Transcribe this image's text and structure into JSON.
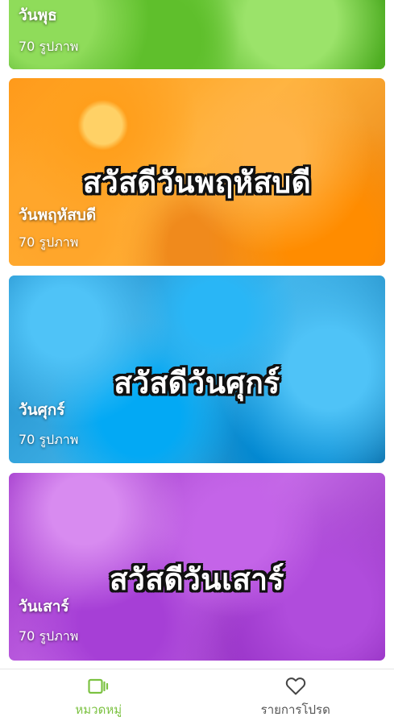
{
  "cards": [
    {
      "id": "wednesday",
      "banner": "",
      "name": "วันพุธ",
      "count": "70 รูปภาพ"
    },
    {
      "id": "thursday",
      "banner": "สวัสดีวันพฤหัสบดี",
      "name": "วันพฤหัสบดี",
      "count": "70 รูปภาพ"
    },
    {
      "id": "friday",
      "banner": "สวัสดีวันศุกร์",
      "name": "วันศุกร์",
      "count": "70 รูปภาพ"
    },
    {
      "id": "saturday",
      "banner": "สวัสดีวันเสาร์",
      "name": "วันเสาร์",
      "count": "70 รูปภาพ"
    }
  ],
  "bottom_nav": {
    "items": [
      {
        "label": "หมวดหมู่",
        "icon": "category-icon",
        "active": true
      },
      {
        "label": "รายการโปรด",
        "icon": "heart-icon",
        "active": false
      }
    ]
  },
  "colors": {
    "accent": "#7cc242",
    "inactive": "#555555"
  }
}
